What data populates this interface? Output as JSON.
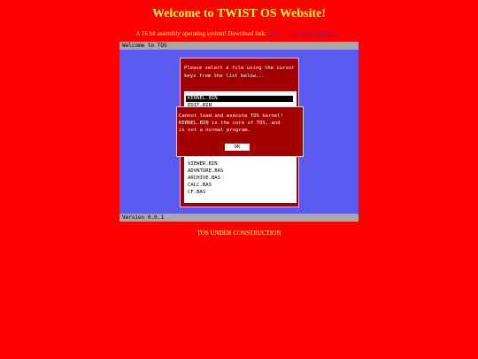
{
  "page": {
    "title": "Welcome to TWIST OS Website!",
    "intro_text": "A 16 bit assembly operating system! Download link:",
    "download_link": "TOS 16 BIT Free Domain OS",
    "footer": "TOS UNDER CONSTRUCTION"
  },
  "tos": {
    "title_bar": "Welcome to TOS",
    "status_bar": "Version 0.0.1",
    "dialog": {
      "prompt_line1": "Please select a file using the cursor",
      "prompt_line2": "keys from the list below...",
      "files": [
        "KERNEL.BIN",
        "EDIT.BIN",
        "",
        "",
        "",
        "",
        "",
        "",
        "",
        "VIEWER.BIN",
        "ADVNTURE.BAS",
        "ARCHIVE.BAS",
        "CALC.BAS",
        "CF.BAS"
      ],
      "selected_index": 0
    },
    "alert": {
      "line1": "Cannot load and execute TOS kernel!",
      "line2": "KERNEL.BIN is the core of TOS, and",
      "line3": "is not a normal program.",
      "ok_label": "OK"
    }
  }
}
